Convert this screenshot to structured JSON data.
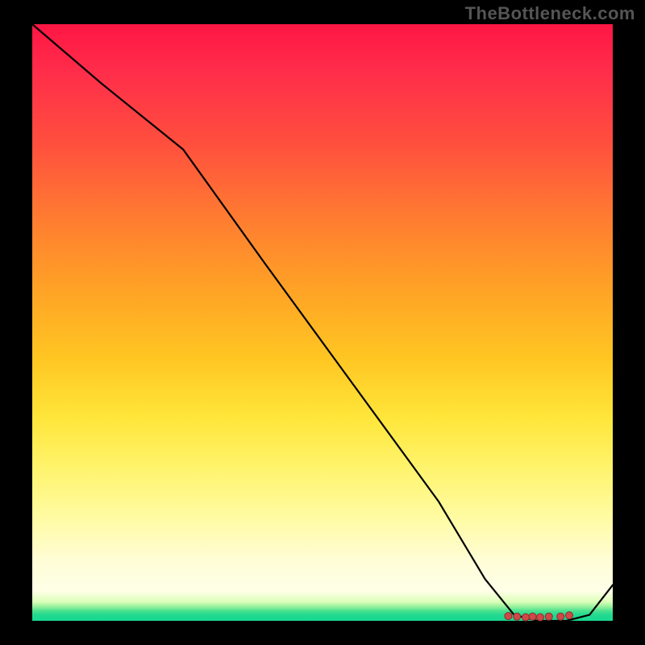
{
  "watermark": "TheBottleneck.com",
  "chart_data": {
    "type": "line",
    "title": "",
    "xlabel": "",
    "ylabel": "",
    "xlim": [
      0,
      100
    ],
    "ylim": [
      0,
      100
    ],
    "grid": false,
    "series": [
      {
        "name": "curve",
        "x": [
          0,
          12,
          26,
          40,
          55,
          70,
          78,
          83,
          87,
          92,
          96,
          100
        ],
        "y": [
          100,
          90,
          79,
          60,
          40,
          20,
          7,
          1,
          0,
          0,
          1,
          6
        ]
      }
    ],
    "points": {
      "name": "cluster",
      "x": [
        82,
        83.5,
        85,
        86.2,
        87.5,
        89,
        91,
        92.5
      ],
      "y": [
        0.8,
        0.7,
        0.6,
        0.7,
        0.6,
        0.7,
        0.7,
        0.9
      ]
    },
    "gradient_note": "background encodes value: red high, green low"
  }
}
